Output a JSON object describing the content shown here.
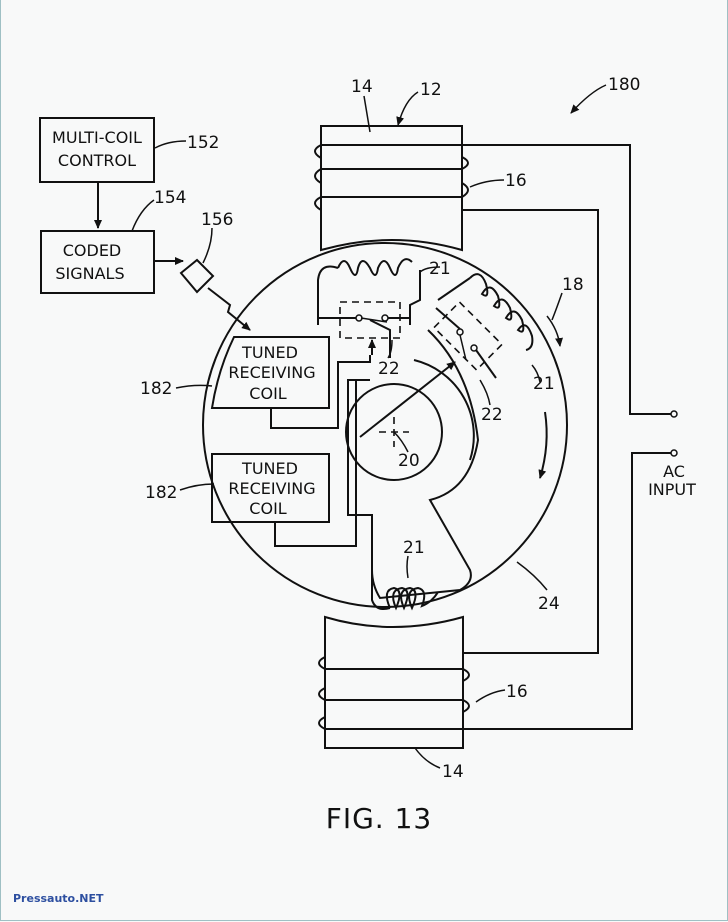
{
  "figure": {
    "title": "FIG. 13",
    "reference_label": "180"
  },
  "blocks": {
    "multi_coil_control": {
      "line1": "MULTI-COIL",
      "line2": "CONTROL",
      "ref": "152"
    },
    "coded_signals": {
      "line1": "CODED",
      "line2": "SIGNALS",
      "ref": "154"
    },
    "transmitter_ref": "156",
    "tuned_coil_upper": {
      "line1": "TUNED",
      "line2": "RECEIVING",
      "line3": "COIL",
      "ref": "182"
    },
    "tuned_coil_lower": {
      "line1": "TUNED",
      "line2": "RECEIVING",
      "line3": "COIL",
      "ref": "182"
    }
  },
  "stator": {
    "top_pole_ref": "14",
    "top_assembly_ref": "12",
    "top_winding_ref": "16",
    "bottom_pole_ref": "14",
    "bottom_winding_ref": "16"
  },
  "rotor": {
    "rotor_ref": "18",
    "shaft_ref": "20",
    "coil_refs": [
      "21",
      "21",
      "21"
    ],
    "switch_refs": [
      "22",
      "22"
    ],
    "body_ref": "24"
  },
  "ac_input": {
    "line1": "AC",
    "line2": "INPUT"
  },
  "watermark": "Pressauto.NET"
}
